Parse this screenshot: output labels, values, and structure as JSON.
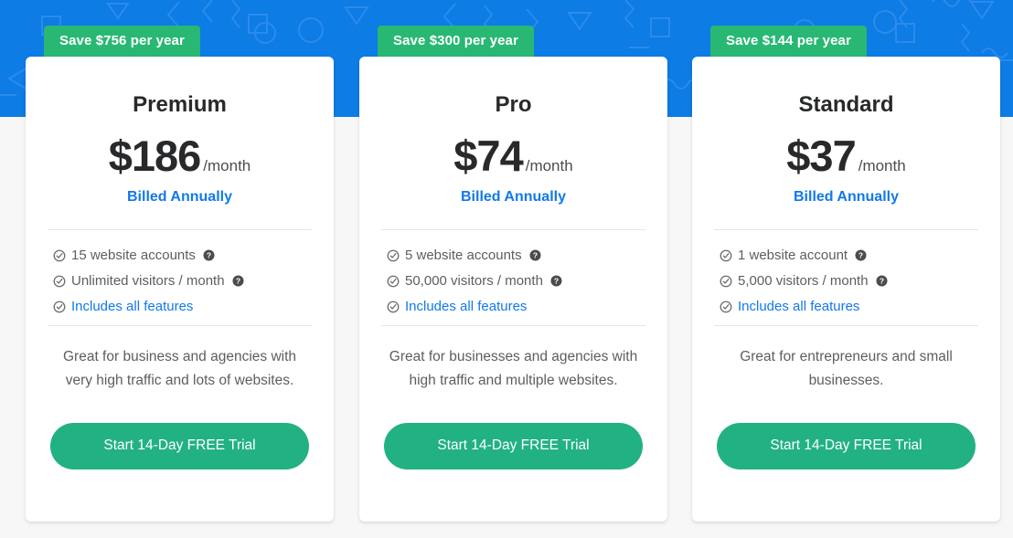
{
  "theme": {
    "banner_blue": "#0d7ce4",
    "pattern_blue": "#2b8bed",
    "badge_green": "#28b873",
    "cta_green": "#22b183",
    "link_blue": "#1179e8",
    "page_background": "#f7f7f7",
    "card_background": "#ffffff",
    "heading_color": "#27292b",
    "body_text_color": "#5b5e61"
  },
  "icons": {
    "check_circle": "check-circle-icon",
    "help": "help-circle-icon"
  },
  "plans": [
    {
      "badge": "Save $756 per year",
      "name": "Premium",
      "price": "$186",
      "period": "/month",
      "billing": "Billed Annually",
      "features": [
        {
          "text": "15 website accounts",
          "has_help": true,
          "is_link": false
        },
        {
          "text": "Unlimited visitors / month",
          "has_help": true,
          "is_link": false
        },
        {
          "text": "Includes all features",
          "has_help": false,
          "is_link": true
        }
      ],
      "description": "Great for business and agencies with very high traffic and lots of websites.",
      "cta": "Start 14-Day FREE Trial"
    },
    {
      "badge": "Save $300 per year",
      "name": "Pro",
      "price": "$74",
      "period": "/month",
      "billing": "Billed Annually",
      "features": [
        {
          "text": "5 website accounts",
          "has_help": true,
          "is_link": false
        },
        {
          "text": "50,000 visitors / month",
          "has_help": true,
          "is_link": false
        },
        {
          "text": "Includes all features",
          "has_help": false,
          "is_link": true
        }
      ],
      "description": "Great for businesses and agencies with high traffic and multiple websites.",
      "cta": "Start 14-Day FREE Trial"
    },
    {
      "badge": "Save $144 per year",
      "name": "Standard",
      "price": "$37",
      "period": "/month",
      "billing": "Billed Annually",
      "features": [
        {
          "text": "1 website account",
          "has_help": true,
          "is_link": false
        },
        {
          "text": "5,000 visitors / month",
          "has_help": true,
          "is_link": false
        },
        {
          "text": "Includes all features",
          "has_help": false,
          "is_link": true
        }
      ],
      "description": "Great for entrepreneurs and small businesses.",
      "cta": "Start 14-Day FREE Trial"
    }
  ]
}
